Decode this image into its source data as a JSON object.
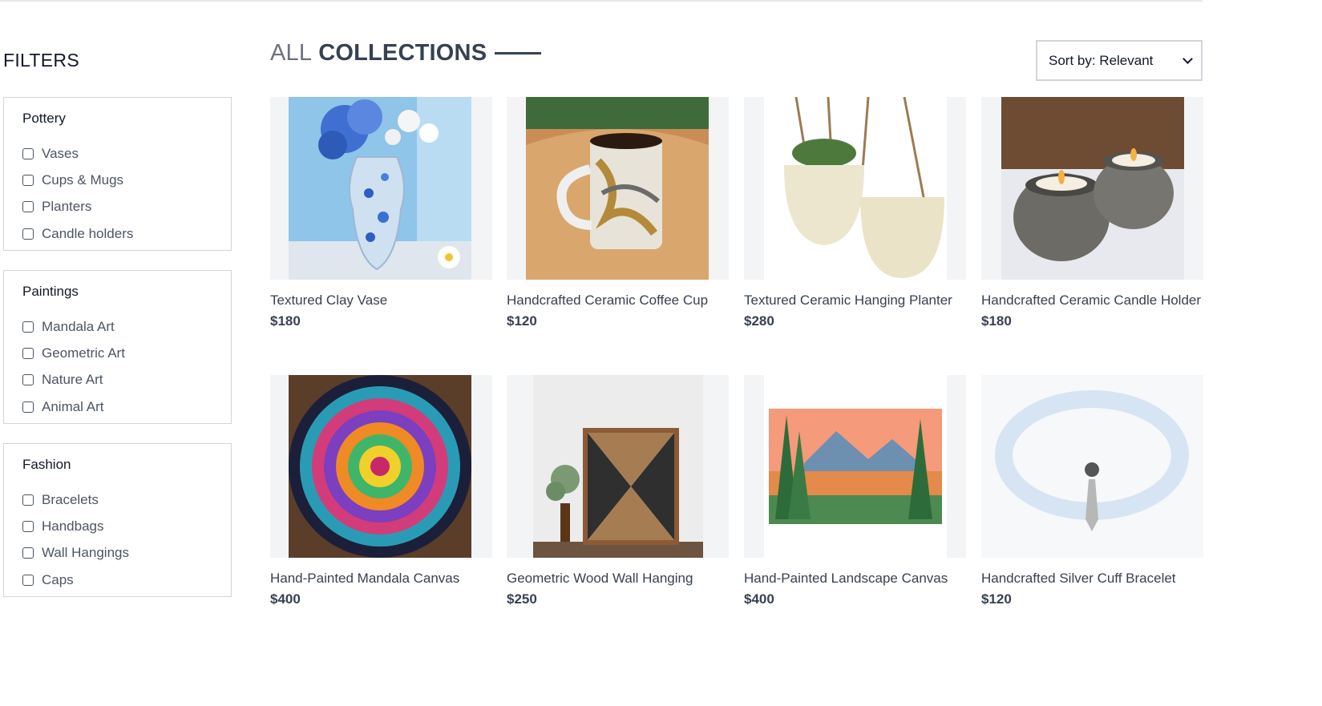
{
  "filters": {
    "title": "FILTERS",
    "groups": [
      {
        "label": "Pottery",
        "options": [
          "Vases",
          "Cups & Mugs",
          "Planters",
          "Candle holders"
        ]
      },
      {
        "label": "Paintings",
        "options": [
          "Mandala Art",
          "Geometric Art",
          "Nature Art",
          "Animal Art"
        ]
      },
      {
        "label": "Fashion",
        "options": [
          "Bracelets",
          "Handbags",
          "Wall Hangings",
          "Caps"
        ]
      }
    ]
  },
  "header": {
    "title_light": "ALL",
    "title_bold": "COLLECTIONS"
  },
  "sort": {
    "value": "Sort by: Relevant"
  },
  "products": [
    {
      "name": "Textured Clay Vase",
      "price": "$180"
    },
    {
      "name": "Handcrafted Ceramic Coffee Cup",
      "price": "$120"
    },
    {
      "name": "Textured Ceramic Hanging Planter",
      "price": "$280"
    },
    {
      "name": "Handcrafted Ceramic Candle Holder",
      "price": "$180"
    },
    {
      "name": "Hand-Painted Mandala Canvas",
      "price": "$400"
    },
    {
      "name": "Geometric Wood Wall Hanging",
      "price": "$250"
    },
    {
      "name": "Hand-Painted Landscape Canvas",
      "price": "$400"
    },
    {
      "name": "Handcrafted Silver Cuff Bracelet",
      "price": "$120"
    }
  ]
}
